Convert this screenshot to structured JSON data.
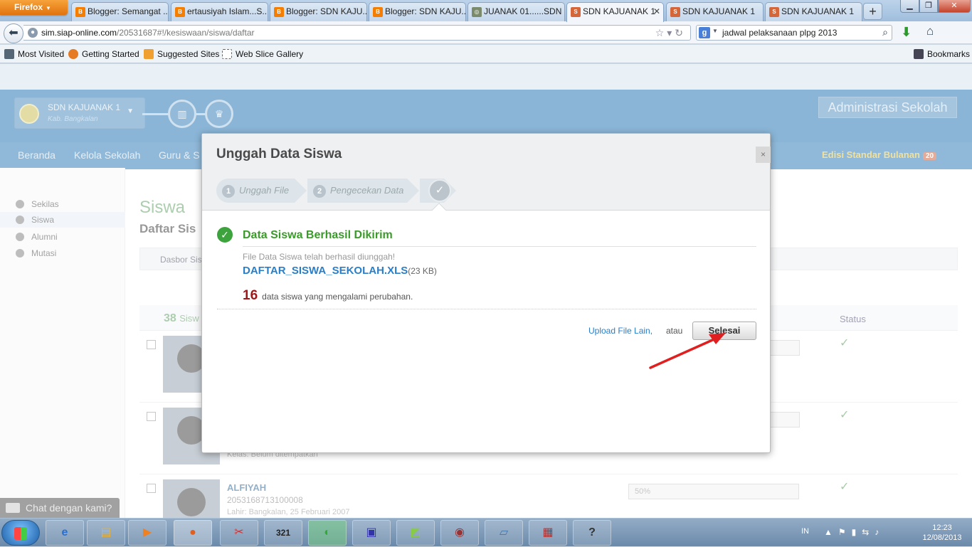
{
  "browser": {
    "app_button": "Firefox",
    "tabs": [
      {
        "label": "Blogger: Semangat ...",
        "fav": "B",
        "color": "#f57d00"
      },
      {
        "label": "ertausiyah Islam...S...",
        "fav": "B",
        "color": "#f57d00"
      },
      {
        "label": "Blogger: SDN KAJU...",
        "fav": "B",
        "color": "#f57d00"
      },
      {
        "label": "Blogger: SDN KAJU...",
        "fav": "B",
        "color": "#f57d00"
      },
      {
        "label": "JUANAK 01......SDN ...",
        "fav": "◎",
        "color": "#7a8a6a"
      },
      {
        "label": "SDN KAJUANAK 1",
        "fav": "S",
        "color": "#d4663a"
      },
      {
        "label": "SDN KAJUANAK 1",
        "fav": "S",
        "color": "#d4663a"
      },
      {
        "label": "SDN KAJUANAK 1",
        "fav": "S",
        "color": "#d4663a"
      }
    ],
    "url_host": "sim.siap-online.com",
    "url_path": "/20531687#!/kesiswaan/siswa/daftar",
    "search_query": "jadwal pelaksanaan plpg 2013",
    "bookmarks": [
      "Most Visited",
      "Getting Started",
      "Suggested Sites",
      "Web Slice Gallery"
    ],
    "bookmarks_menu": "Bookmarks"
  },
  "site": {
    "school_name": "SDN KAJUANAK 1",
    "school_location": "Kab. Bangkalan",
    "admin_label": "Administrasi Sekolah",
    "nav": [
      "Beranda",
      "Kelola Sekolah",
      "Guru & S"
    ],
    "edition": "Edisi Standar Bulanan",
    "edition_badge": "20",
    "sidebar": [
      "Sekilas",
      "Siswa",
      "Alumni",
      "Mutasi"
    ],
    "title": "Siswa",
    "subtitle": "Daftar Sis",
    "breadcrumb": "Dasbor Sis",
    "count": "38",
    "count_label": "Sisw",
    "status_header": "Status",
    "row3_name": "ALFIYAH",
    "row3_id": "2053168713100008",
    "row3_birth": "Lahir: Bangkalan, 25 Februari 2007",
    "row2_class": "Kelas: Belum ditempatkan",
    "row3_progress": "50%",
    "chat": "Chat dengan kami?"
  },
  "modal": {
    "title": "Unggah Data Siswa",
    "close": "×",
    "step1": "Unggah File",
    "step2": "Pengecekan Data",
    "success_title": "Data Siswa Berhasil Dikirim",
    "desc": "File Data Siswa telah berhasil diunggah!",
    "file_name": "DAFTAR_SISWA_SEKOLAH.XLS",
    "file_size": "(23 KB)",
    "changed_count": "16",
    "changed_text": "data siswa yang mengalami perubahan.",
    "upload_other": "Upload File Lain,",
    "or": "atau",
    "done_button": "Selesai"
  },
  "taskbar": {
    "lang": "IN",
    "time": "12:23",
    "date": "12/08/2013"
  }
}
